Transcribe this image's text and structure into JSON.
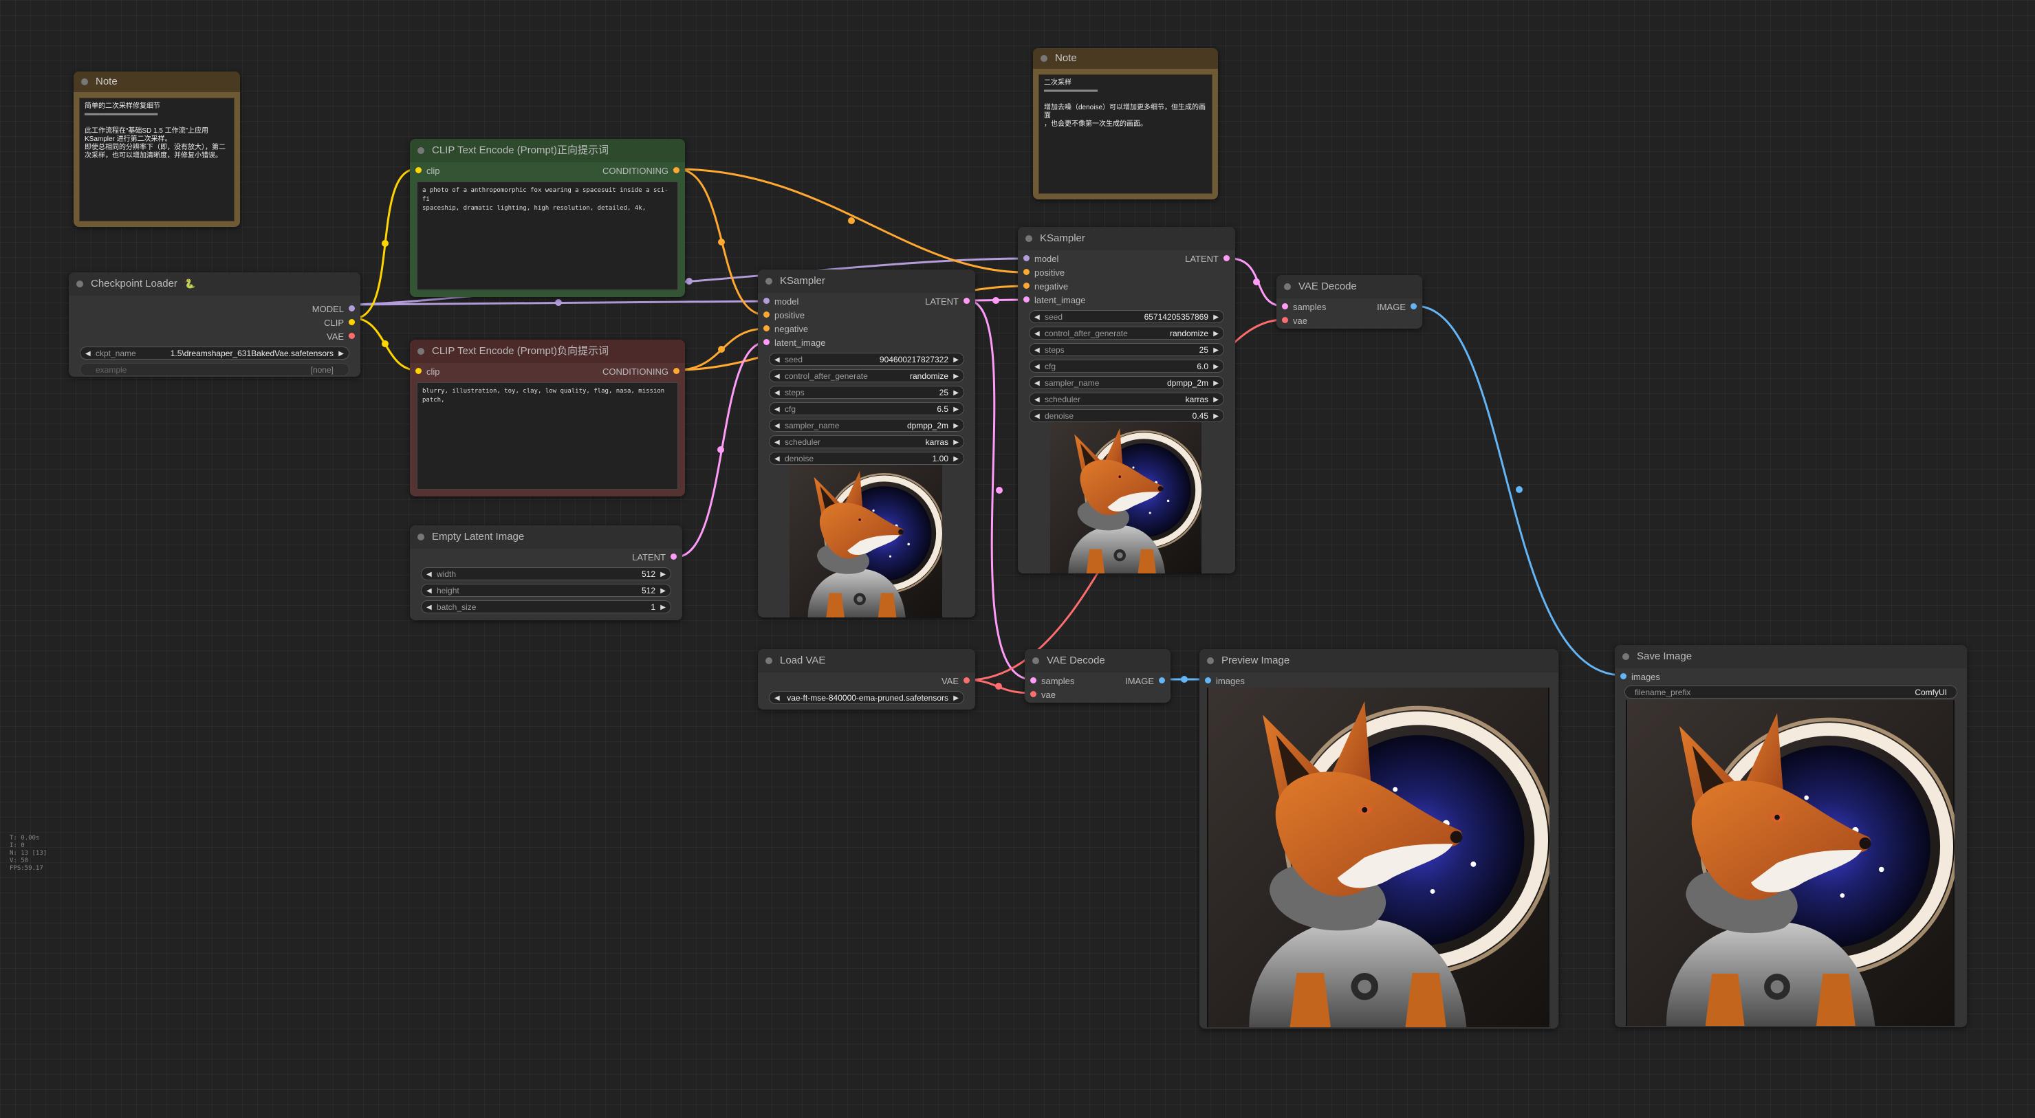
{
  "colors": {
    "canvas": "#222222",
    "node_bg": "#353535",
    "model": "#b39ddb",
    "clip": "#ffd500",
    "vae": "#ff6e6e",
    "conditioning": "#ffa931",
    "latent": "#ff9cf9",
    "image": "#64b5f6",
    "note_frame": "#6e5a35",
    "positive_node": "#2d4a2d",
    "negative_node": "#4d2a2a"
  },
  "note1": {
    "title": "Note",
    "text": "简单的二次采样修复细节\n═══════════════\n\n此工作流程在“基础SD 1.5 工作流”上应用\nKSampler 进行第二次采样。\n即使总相同的分辨率下（即，没有放大），第二\n次采样，也可以增加清晰度，并修复小错误。"
  },
  "note2": {
    "title": "Note",
    "text": "二次采样\n═══════════\n\n增加去噪（denoise）可以增加更多细节，但生成的画面\n，也会更不像第一次生成的画面。"
  },
  "checkpoint_loader": {
    "title": "Checkpoint Loader",
    "badge": "🐍",
    "outputs": [
      "MODEL",
      "CLIP",
      "VAE"
    ],
    "ckpt_label": "ckpt_name",
    "ckpt_value": "1.5\\dreamshaper_631BakedVae.safetensors",
    "example_label": "example",
    "example_value": "[none]"
  },
  "clip_positive": {
    "title": "CLIP Text Encode (Prompt)正向提示词",
    "input": "clip",
    "output": "CONDITIONING",
    "text": "a photo of a anthropomorphic fox wearing a spacesuit inside a sci-fi\nspaceship, dramatic lighting, high resolution, detailed, 4k,"
  },
  "clip_negative": {
    "title": "CLIP Text Encode (Prompt)负向提示词",
    "input": "clip",
    "output": "CONDITIONING",
    "text": "blurry, illustration, toy, clay, low quality, flag, nasa, mission patch,"
  },
  "empty_latent": {
    "title": "Empty Latent Image",
    "output": "LATENT",
    "widgets": [
      {
        "label": "width",
        "value": "512"
      },
      {
        "label": "height",
        "value": "512"
      },
      {
        "label": "batch_size",
        "value": "1"
      }
    ]
  },
  "ksampler1": {
    "title": "KSampler",
    "inputs": [
      "model",
      "positive",
      "negative",
      "latent_image"
    ],
    "output": "LATENT",
    "widgets": [
      {
        "label": "seed",
        "value": "904600217827322"
      },
      {
        "label": "control_after_generate",
        "value": "randomize"
      },
      {
        "label": "steps",
        "value": "25"
      },
      {
        "label": "cfg",
        "value": "6.5"
      },
      {
        "label": "sampler_name",
        "value": "dpmpp_2m"
      },
      {
        "label": "scheduler",
        "value": "karras"
      },
      {
        "label": "denoise",
        "value": "1.00"
      }
    ]
  },
  "ksampler2": {
    "title": "KSampler",
    "inputs": [
      "model",
      "positive",
      "negative",
      "latent_image"
    ],
    "output": "LATENT",
    "widgets": [
      {
        "label": "seed",
        "value": "657142053578​69"
      },
      {
        "label": "control_after_generate",
        "value": "randomize"
      },
      {
        "label": "steps",
        "value": "25"
      },
      {
        "label": "cfg",
        "value": "6.0"
      },
      {
        "label": "sampler_name",
        "value": "dpmpp_2m"
      },
      {
        "label": "scheduler",
        "value": "karras"
      },
      {
        "label": "denoise",
        "value": "0.45"
      }
    ]
  },
  "vae_decode1": {
    "title": "VAE Decode",
    "inputs": [
      "samples",
      "vae"
    ],
    "output": "IMAGE"
  },
  "vae_decode2": {
    "title": "VAE Decode",
    "inputs": [
      "samples",
      "vae"
    ],
    "output": "IMAGE"
  },
  "load_vae": {
    "title": "Load VAE",
    "output": "VAE",
    "vae_value": "vae-ft-mse-840000-ema-pruned.safetensors"
  },
  "preview_image": {
    "title": "Preview Image",
    "input": "images"
  },
  "save_image": {
    "title": "Save Image",
    "input": "images",
    "prefix_label": "filename_prefix",
    "prefix_value": "ComfyUI"
  },
  "stats": {
    "lines": [
      "T: 0.00s",
      "I: 0",
      "N: 13 [13]",
      "V: 50",
      "FPS:59.17"
    ]
  }
}
